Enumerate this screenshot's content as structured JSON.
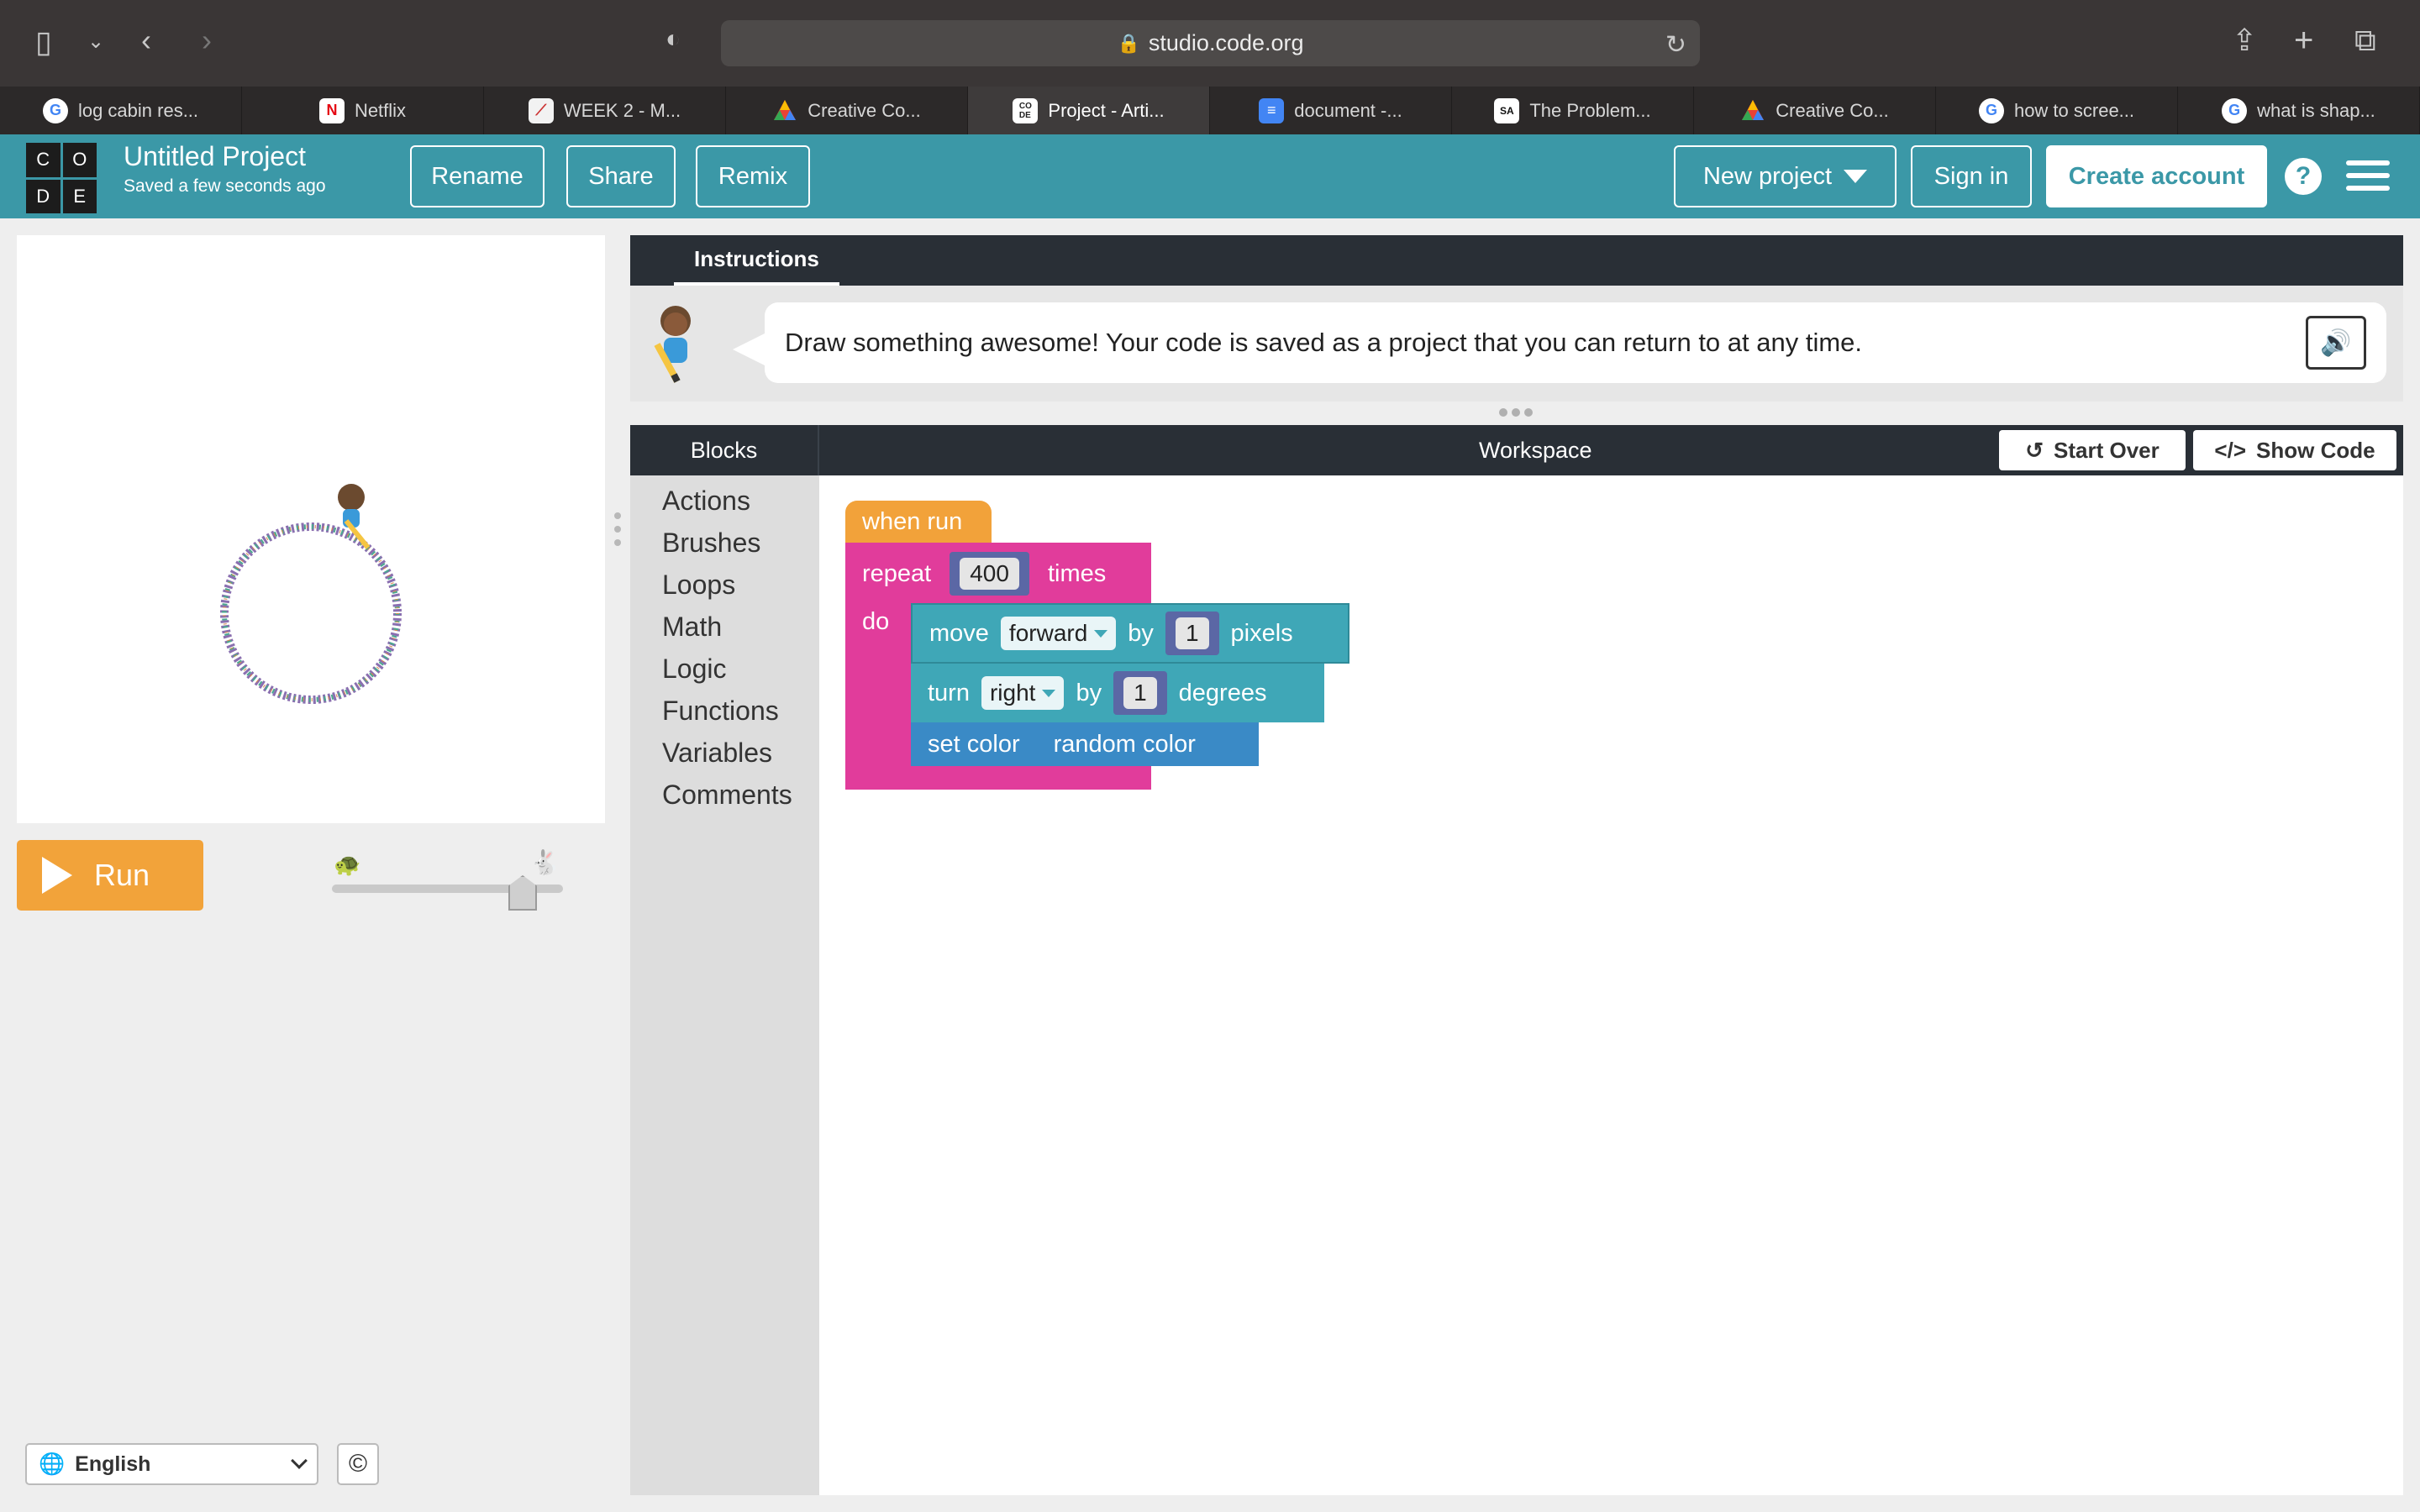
{
  "browser": {
    "url": "studio.code.org",
    "tabs": [
      {
        "label": "log cabin res...",
        "icon": "google-icon"
      },
      {
        "label": "Netflix",
        "icon": "netflix-icon"
      },
      {
        "label": "WEEK 2 - M...",
        "icon": "chart-icon"
      },
      {
        "label": "Creative Co...",
        "icon": "creative-icon"
      },
      {
        "label": "Project - Arti...",
        "icon": "code-org-icon",
        "active": true
      },
      {
        "label": "document -...",
        "icon": "docs-icon"
      },
      {
        "label": "The Problem...",
        "icon": "sciam-icon"
      },
      {
        "label": "Creative Co...",
        "icon": "creative-icon"
      },
      {
        "label": "how to scree...",
        "icon": "google-icon"
      },
      {
        "label": "what is shap...",
        "icon": "google-icon"
      }
    ]
  },
  "header": {
    "logo_letters": [
      "C",
      "O",
      "D",
      "E"
    ],
    "project_title": "Untitled Project",
    "saved_status": "Saved a few seconds ago",
    "rename": "Rename",
    "share": "Share",
    "remix": "Remix",
    "new_project": "New project",
    "sign_in": "Sign in",
    "create_account": "Create account",
    "help": "?"
  },
  "left": {
    "run": "Run",
    "language": "English",
    "copyright": "©"
  },
  "instructions": {
    "tab": "Instructions",
    "text": "Draw something awesome! Your code is saved as a project that you can return to at any time."
  },
  "workspace": {
    "blocks_label": "Blocks",
    "title": "Workspace",
    "start_over": "Start Over",
    "show_code": "Show Code",
    "categories": [
      "Actions",
      "Brushes",
      "Loops",
      "Math",
      "Logic",
      "Functions",
      "Variables",
      "Comments"
    ]
  },
  "program": {
    "when_run": "when run",
    "repeat": "repeat",
    "repeat_count": "400",
    "times": "times",
    "do": "do",
    "move": "move",
    "move_dir": "forward",
    "by": "by",
    "move_amount": "1",
    "pixels": "pixels",
    "turn": "turn",
    "turn_dir": "right",
    "turn_amount": "1",
    "degrees": "degrees",
    "set_color": "set color",
    "color_value": "random color"
  },
  "colors": {
    "header_teal": "#3b98a7",
    "run_orange": "#f2a33a",
    "event_block": "#f2a23a",
    "loop_block": "#e13c9b",
    "action_block": "#3fa7b7",
    "color_block": "#3a8ac6",
    "number_slot": "#5b67a5"
  }
}
